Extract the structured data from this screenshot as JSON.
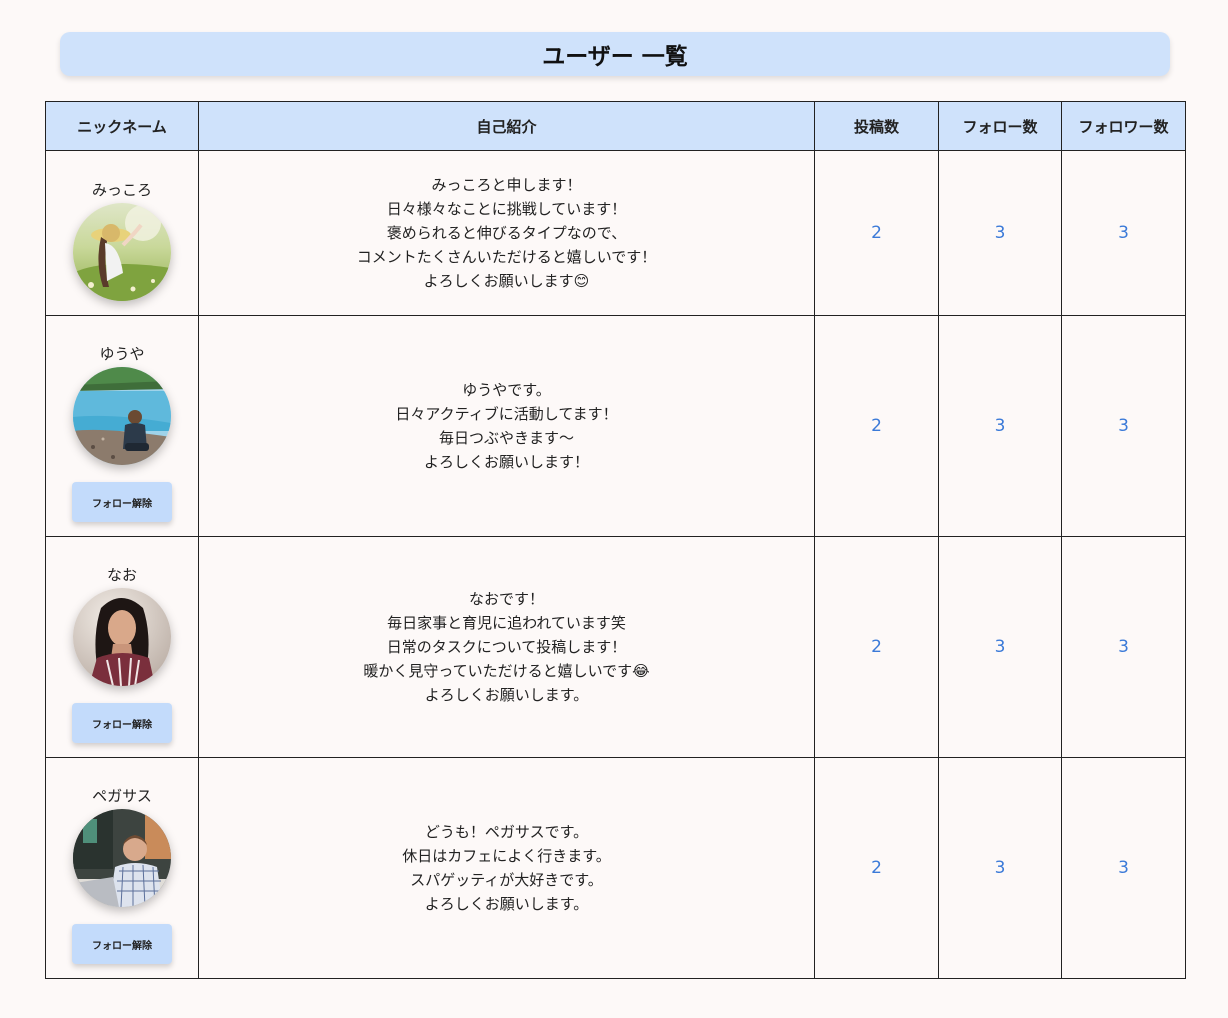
{
  "page_title": "ユーザー 一覧",
  "columns": [
    "ニックネーム",
    "自己紹介",
    "投稿数",
    "フォロー数",
    "フォロワー数"
  ],
  "users": [
    {
      "nickname": "みっころ",
      "avatar": "avatar-woman-in-field",
      "bio": [
        "みっころと申します！",
        "日々様々なことに挑戦しています！",
        "褒められると伸びるタイプなので、",
        "コメントたくさんいただけると嬉しいです！",
        "よろしくお願いします😊"
      ],
      "posts": "2",
      "following": "3",
      "followers": "3",
      "button": ""
    },
    {
      "nickname": "ゆうや",
      "avatar": "avatar-boy-by-lake",
      "bio": [
        "ゆうやです。",
        "日々アクティブに活動してます！",
        "毎日つぶやきます〜",
        "よろしくお願いします！"
      ],
      "posts": "2",
      "following": "3",
      "followers": "3",
      "button": "フォロー解除"
    },
    {
      "nickname": "なお",
      "avatar": "avatar-woman-portrait",
      "bio": [
        "なおです！",
        "毎日家事と育児に追われています笑",
        "日常のタスクについて投稿します！",
        "暖かく見守っていただけると嬉しいです😂",
        "よろしくお願いします。"
      ],
      "posts": "2",
      "following": "3",
      "followers": "3",
      "button": "フォロー解除"
    },
    {
      "nickname": "ペガサス",
      "avatar": "avatar-man-with-laptop",
      "bio": [
        "どうも！ペガサスです。",
        "休日はカフェによく行きます。",
        "スパゲッティが大好きです。",
        "よろしくお願いします。"
      ],
      "posts": "2",
      "following": "3",
      "followers": "3",
      "button": "フォロー解除"
    }
  ],
  "colors": {
    "header_bg": "#cfe2fb",
    "button_bg": "#c3dbfb",
    "number_link": "#3b7ad8",
    "page_bg": "#fdf9f8"
  }
}
